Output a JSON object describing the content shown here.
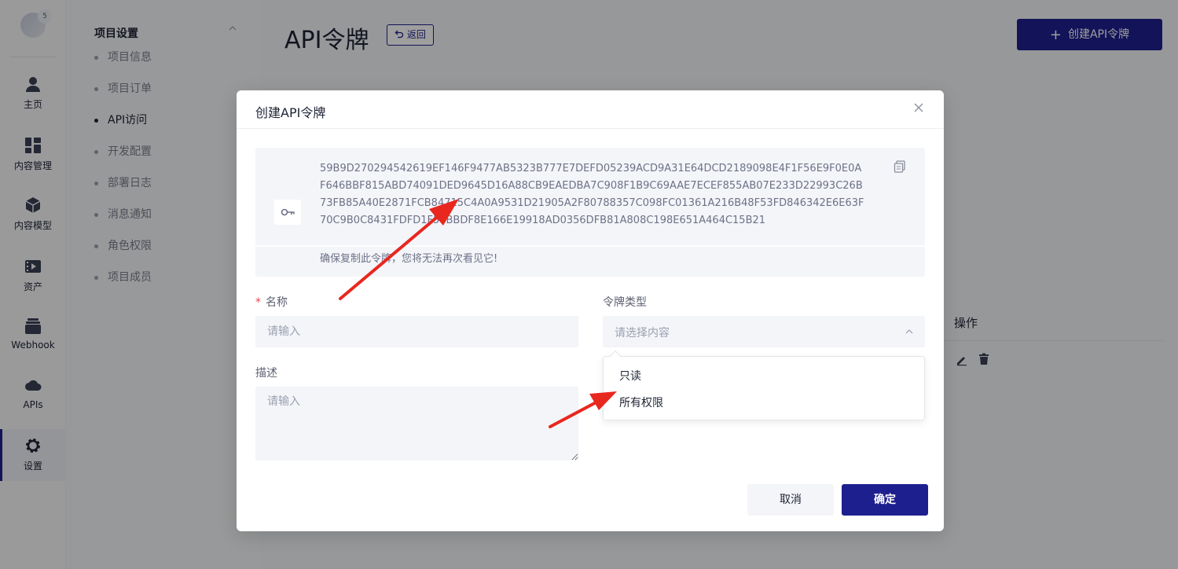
{
  "rail": {
    "badge": "5",
    "items": [
      {
        "label": "主页",
        "icon": "user-icon"
      },
      {
        "label": "内容管理",
        "icon": "grid-icon"
      },
      {
        "label": "内容模型",
        "icon": "cube-icon"
      },
      {
        "label": "资产",
        "icon": "media-icon"
      },
      {
        "label": "Webhook",
        "icon": "layers-icon"
      },
      {
        "label": "APIs",
        "icon": "cloud-api-icon"
      },
      {
        "label": "设置",
        "icon": "gear-icon"
      }
    ]
  },
  "subnav": {
    "title": "项目设置",
    "items": [
      "项目信息",
      "项目订单",
      "API访问",
      "开发配置",
      "部署日志",
      "消息通知",
      "角色权限",
      "项目成员"
    ],
    "active": "API访问"
  },
  "page": {
    "title": "API令牌",
    "back_label": "返回",
    "create_label": "创建API令牌",
    "ops_header": "操作"
  },
  "modal": {
    "title": "创建API令牌",
    "token": "59B9D270294542619EF146F9477AB5323B777E7DEFD05239ACD9A31E64DCD2189098E4F1F56E9F0E0AF646BBF815ABD74091DED9645D16A88CB9EAEDBA7C908F1B9C69AAE7ECEF855AB07E233D22993C26B73FB85A40E2871FCB84715C4A0A9531D21905A2F80788357C098FC01361A216B48F53FD846342E6E63F70C9B0C8431FDFD1F54BBDF8E166E19918AD0356DFB81A808C198E651A464C15B21",
    "warning": "确保复制此令牌，您将无法再次看见它!",
    "name_label": "名称",
    "name_placeholder": "请输入",
    "type_label": "令牌类型",
    "type_placeholder": "请选择内容",
    "desc_label": "描述",
    "desc_placeholder": "请输入",
    "type_options": [
      "只读",
      "所有权限"
    ],
    "cancel_label": "取消",
    "ok_label": "确定"
  },
  "colors": {
    "brand": "#1e1f8f",
    "required": "#e5484d",
    "annotation": "#e8271f"
  }
}
